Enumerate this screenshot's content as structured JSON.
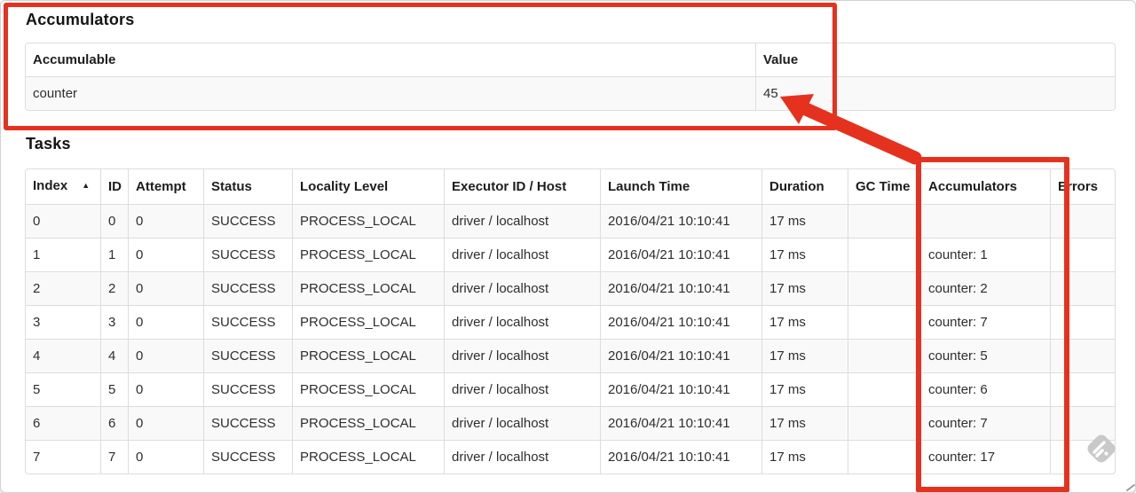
{
  "annotation": {
    "color": "#e5321f",
    "shapes": [
      "box-around-accumulators-section",
      "box-around-accumulators-column",
      "arrow-to-value-45"
    ]
  },
  "accumulators": {
    "heading": "Accumulators",
    "columns": {
      "accumulable": "Accumulable",
      "value": "Value"
    },
    "rows": [
      {
        "accumulable": "counter",
        "value": "45"
      }
    ]
  },
  "tasks": {
    "heading": "Tasks",
    "sort_icon": "▲",
    "columns": [
      "Index",
      "ID",
      "Attempt",
      "Status",
      "Locality Level",
      "Executor ID / Host",
      "Launch Time",
      "Duration",
      "GC Time",
      "Accumulators",
      "Errors"
    ],
    "rows": [
      {
        "index": "0",
        "id": "0",
        "attempt": "0",
        "status": "SUCCESS",
        "locality_level": "PROCESS_LOCAL",
        "executor": "driver / localhost",
        "launch_time": "2016/04/21 10:10:41",
        "duration": "17 ms",
        "gc_time": "",
        "accumulators": "",
        "errors": ""
      },
      {
        "index": "1",
        "id": "1",
        "attempt": "0",
        "status": "SUCCESS",
        "locality_level": "PROCESS_LOCAL",
        "executor": "driver / localhost",
        "launch_time": "2016/04/21 10:10:41",
        "duration": "17 ms",
        "gc_time": "",
        "accumulators": "counter: 1",
        "errors": ""
      },
      {
        "index": "2",
        "id": "2",
        "attempt": "0",
        "status": "SUCCESS",
        "locality_level": "PROCESS_LOCAL",
        "executor": "driver / localhost",
        "launch_time": "2016/04/21 10:10:41",
        "duration": "17 ms",
        "gc_time": "",
        "accumulators": "counter: 2",
        "errors": ""
      },
      {
        "index": "3",
        "id": "3",
        "attempt": "0",
        "status": "SUCCESS",
        "locality_level": "PROCESS_LOCAL",
        "executor": "driver / localhost",
        "launch_time": "2016/04/21 10:10:41",
        "duration": "17 ms",
        "gc_time": "",
        "accumulators": "counter: 7",
        "errors": ""
      },
      {
        "index": "4",
        "id": "4",
        "attempt": "0",
        "status": "SUCCESS",
        "locality_level": "PROCESS_LOCAL",
        "executor": "driver / localhost",
        "launch_time": "2016/04/21 10:10:41",
        "duration": "17 ms",
        "gc_time": "",
        "accumulators": "counter: 5",
        "errors": ""
      },
      {
        "index": "5",
        "id": "5",
        "attempt": "0",
        "status": "SUCCESS",
        "locality_level": "PROCESS_LOCAL",
        "executor": "driver / localhost",
        "launch_time": "2016/04/21 10:10:41",
        "duration": "17 ms",
        "gc_time": "",
        "accumulators": "counter: 6",
        "errors": ""
      },
      {
        "index": "6",
        "id": "6",
        "attempt": "0",
        "status": "SUCCESS",
        "locality_level": "PROCESS_LOCAL",
        "executor": "driver / localhost",
        "launch_time": "2016/04/21 10:10:41",
        "duration": "17 ms",
        "gc_time": "",
        "accumulators": "counter: 7",
        "errors": ""
      },
      {
        "index": "7",
        "id": "7",
        "attempt": "0",
        "status": "SUCCESS",
        "locality_level": "PROCESS_LOCAL",
        "executor": "driver / localhost",
        "launch_time": "2016/04/21 10:10:41",
        "duration": "17 ms",
        "gc_time": "",
        "accumulators": "counter: 17",
        "errors": ""
      }
    ]
  }
}
